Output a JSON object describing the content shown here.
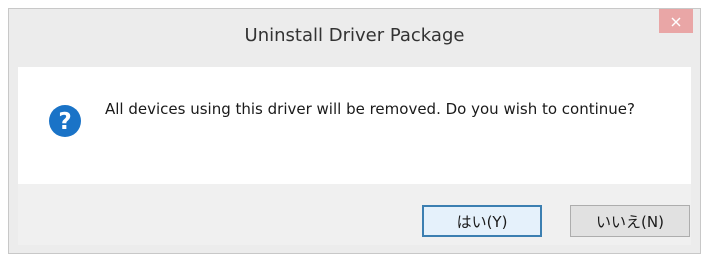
{
  "dialog": {
    "title": "Uninstall Driver Package",
    "close_icon": "close-icon",
    "question_icon": "question-icon",
    "message": "All devices using this driver will be removed.  Do you wish to continue?",
    "buttons": {
      "yes_label": "はい(Y)",
      "no_label": "いいえ(N)"
    }
  },
  "colors": {
    "frame_bg": "#ececec",
    "close_button_bg": "#e9a6a6",
    "icon_blue": "#1a73c7",
    "default_button_border": "#3c7fb1"
  }
}
